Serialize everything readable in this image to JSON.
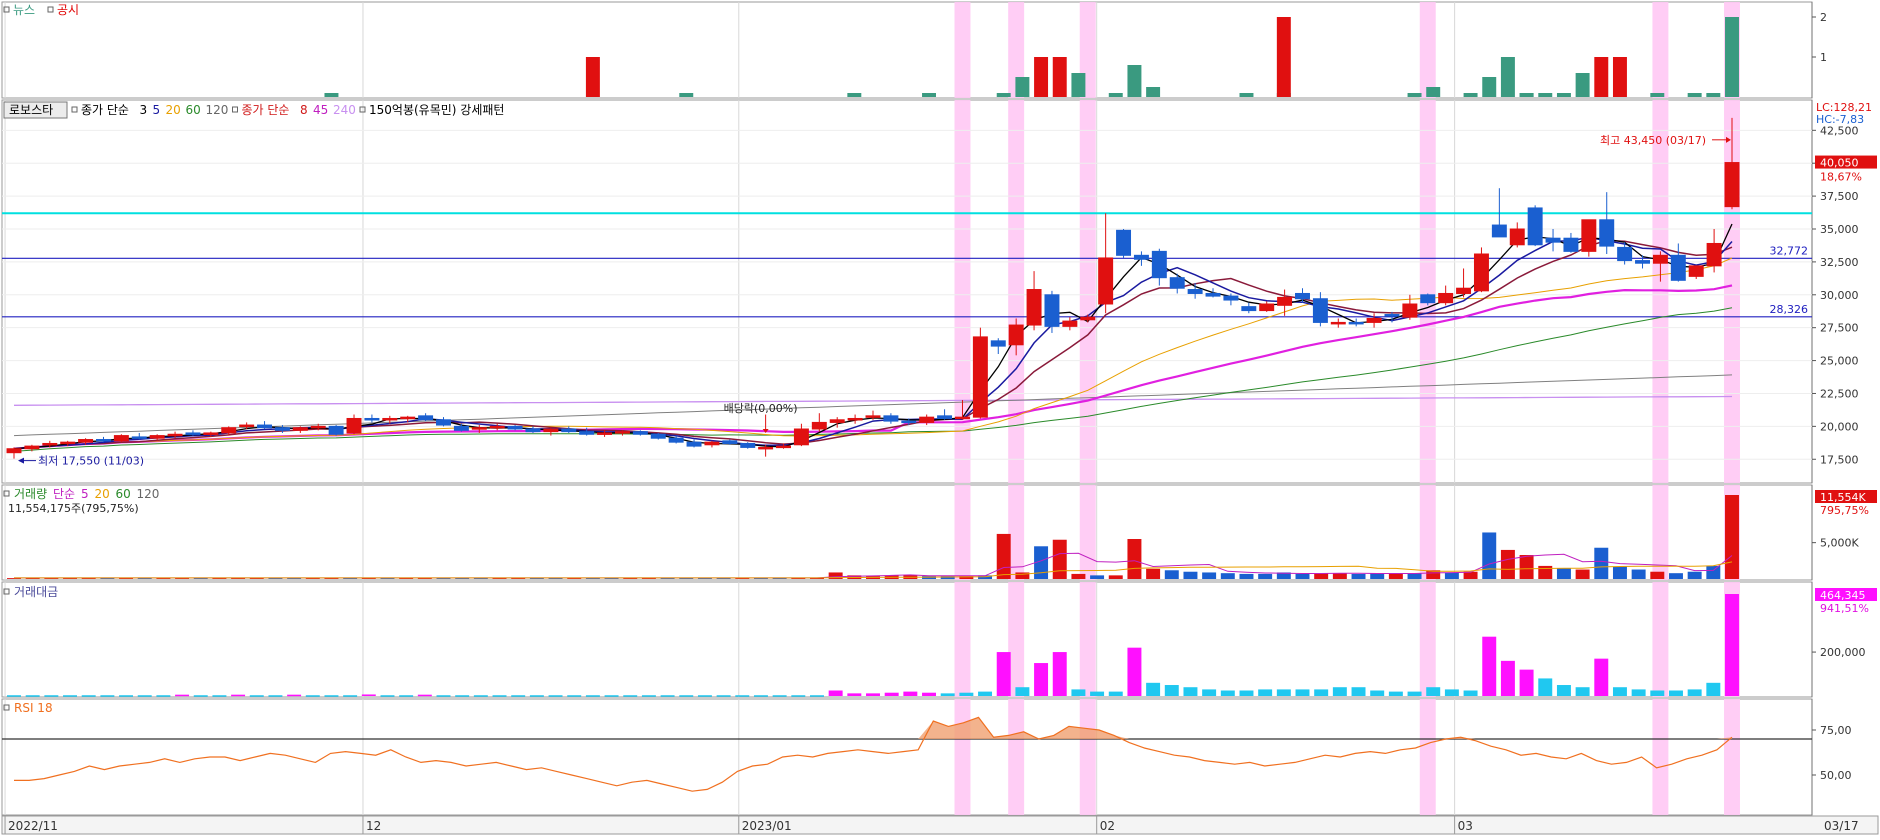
{
  "panels": {
    "news": {
      "legend": [
        "뉴스",
        "공시"
      ],
      "legend_colors": [
        "#3a9a80",
        "#e00000"
      ],
      "ticks": [
        "2",
        "1"
      ]
    },
    "price": {
      "legend_button": "로보스타",
      "legend_items": [
        {
          "text": "종가 단순",
          "color": "#000000"
        },
        {
          "text": "3",
          "color": "#000000"
        },
        {
          "text": "5",
          "color": "#1a1aa0"
        },
        {
          "text": "20",
          "color": "#e8a000"
        },
        {
          "text": "60",
          "color": "#2a8a2a"
        },
        {
          "text": "120",
          "color": "#666666"
        },
        {
          "text": "종가 단순",
          "color": "#d01a1a"
        },
        {
          "text": "8",
          "color": "#d01a1a"
        },
        {
          "text": "45",
          "color": "#c020c0"
        },
        {
          "text": "240",
          "color": "#c890f0"
        },
        {
          "text": "150억봉(유목민) 강세패턴",
          "color": "#000000"
        }
      ],
      "right_top_lc": "LC:128,21",
      "right_top_hc": "HC:-7,83",
      "current_price": "40,050",
      "current_change": "18,67%",
      "high_annotation": "최고 43,450 (03/17)",
      "low_annotation": "최저 17,550 (11/03)",
      "dividend_annotation": "배당락(0,00%)",
      "level_labels": [
        "32,772",
        "28,326"
      ],
      "ticks": [
        "42,500",
        "40,000",
        "37,500",
        "35,000",
        "32,500",
        "30,000",
        "27,500",
        "25,000",
        "22,500",
        "20,000",
        "17,500"
      ]
    },
    "volume": {
      "legend": [
        "거래량",
        "단순",
        "5",
        "20",
        "60",
        "120"
      ],
      "legend_colors": [
        "#2a8a2a",
        "#c020c0",
        "#c020c0",
        "#e8a000",
        "#2a8a2a",
        "#666666"
      ],
      "info": "11,554,175주(795,75%)",
      "current_value": "11,554K",
      "current_pct": "795,75%",
      "ticks": [
        "5,000K"
      ]
    },
    "amount": {
      "legend": "거래대금",
      "current_value": "464,345",
      "current_pct": "941,51%",
      "ticks": [
        "200,000"
      ]
    },
    "rsi": {
      "legend": "RSI 18",
      "ticks": [
        "75,00",
        "50,00"
      ]
    }
  },
  "x_axis": {
    "labels": [
      "2022/11",
      "12",
      "2023/01",
      "02",
      "03"
    ],
    "end_label": "03/17"
  },
  "chart_data": {
    "type": "candlestick",
    "symbol": "로보스타",
    "n_bars": 84,
    "ylim": [
      16000,
      44500
    ],
    "x_labels": [
      {
        "index": 0,
        "text": "2022/11"
      },
      {
        "index": 20,
        "text": "12"
      },
      {
        "index": 41,
        "text": "2023/01"
      },
      {
        "index": 61,
        "text": "02"
      },
      {
        "index": 81,
        "text": "03"
      }
    ],
    "highlight_bars": [
      53,
      56,
      60,
      79,
      92
    ],
    "horizontal_levels": [
      {
        "value": 36200,
        "color": "#00e0e0"
      },
      {
        "value": 32772,
        "color": "#2020c0"
      },
      {
        "value": 28326,
        "color": "#2020c0"
      }
    ],
    "ohlc": [
      [
        18000,
        18400,
        17550,
        18300
      ],
      [
        18300,
        18600,
        18100,
        18500
      ],
      [
        18600,
        18900,
        18400,
        18700
      ],
      [
        18700,
        18900,
        18500,
        18800
      ],
      [
        18800,
        19100,
        18600,
        19000
      ],
      [
        19000,
        19200,
        18800,
        18900
      ],
      [
        18900,
        19400,
        18800,
        19300
      ],
      [
        19200,
        19500,
        19000,
        19100
      ],
      [
        19100,
        19400,
        18900,
        19300
      ],
      [
        19300,
        19600,
        19100,
        19400
      ],
      [
        19500,
        19700,
        19300,
        19400
      ],
      [
        19400,
        19600,
        19200,
        19500
      ],
      [
        19500,
        20000,
        19300,
        19900
      ],
      [
        20000,
        20300,
        19800,
        20100
      ],
      [
        20100,
        20400,
        19800,
        19900
      ],
      [
        19900,
        20100,
        19500,
        19700
      ],
      [
        19700,
        20000,
        19500,
        19900
      ],
      [
        19900,
        20200,
        19700,
        20000
      ],
      [
        20000,
        20100,
        19300,
        19400
      ],
      [
        19500,
        20900,
        19400,
        20600
      ],
      [
        20600,
        20900,
        20300,
        20500
      ],
      [
        20500,
        20800,
        20200,
        20600
      ],
      [
        20600,
        20800,
        20300,
        20700
      ],
      [
        20800,
        21000,
        20400,
        20500
      ],
      [
        20500,
        20700,
        20000,
        20100
      ],
      [
        20000,
        20200,
        19600,
        19700
      ],
      [
        19800,
        20100,
        19500,
        19900
      ],
      [
        19900,
        20200,
        19700,
        20000
      ],
      [
        20000,
        20100,
        19700,
        19800
      ],
      [
        19800,
        20000,
        19500,
        19600
      ],
      [
        19600,
        19900,
        19300,
        19800
      ],
      [
        19800,
        20000,
        19500,
        19600
      ],
      [
        19600,
        19900,
        19300,
        19400
      ],
      [
        19400,
        19700,
        19200,
        19500
      ],
      [
        19500,
        19700,
        19300,
        19600
      ],
      [
        19600,
        19700,
        19300,
        19400
      ],
      [
        19400,
        19500,
        19000,
        19100
      ],
      [
        19100,
        19300,
        18700,
        18800
      ],
      [
        18800,
        19000,
        18400,
        18500
      ],
      [
        18600,
        18900,
        18400,
        18800
      ],
      [
        18900,
        19000,
        18600,
        18700
      ],
      [
        18700,
        18800,
        18300,
        18400
      ],
      [
        18300,
        18600,
        17700,
        18400
      ],
      [
        18400,
        18700,
        18300,
        18500
      ],
      [
        18600,
        20200,
        18500,
        19800
      ],
      [
        19800,
        21000,
        19600,
        20300
      ],
      [
        20300,
        20700,
        19900,
        20500
      ],
      [
        20500,
        20900,
        20200,
        20600
      ],
      [
        20700,
        21200,
        20500,
        20800
      ],
      [
        20800,
        21000,
        20200,
        20400
      ],
      [
        20400,
        20600,
        20100,
        20300
      ],
      [
        20300,
        20900,
        20100,
        20700
      ],
      [
        20800,
        21300,
        20500,
        20600
      ],
      [
        20600,
        22000,
        20500,
        20700
      ],
      [
        20700,
        27500,
        20600,
        26800
      ],
      [
        26500,
        26700,
        25500,
        26100
      ],
      [
        26200,
        28200,
        25400,
        27700
      ],
      [
        27700,
        31800,
        27300,
        30400
      ],
      [
        30000,
        30300,
        27100,
        27600
      ],
      [
        27600,
        28300,
        27300,
        28000
      ],
      [
        28100,
        28500,
        27900,
        28300
      ],
      [
        29300,
        36200,
        28600,
        32800
      ],
      [
        34900,
        35000,
        32800,
        33000
      ],
      [
        33000,
        33300,
        32200,
        32700
      ],
      [
        33300,
        33500,
        30700,
        31300
      ],
      [
        31300,
        31600,
        30100,
        30500
      ],
      [
        30400,
        30900,
        29700,
        30100
      ],
      [
        30100,
        30500,
        29800,
        29900
      ],
      [
        29900,
        30100,
        29200,
        29600
      ],
      [
        29100,
        29400,
        28600,
        28800
      ],
      [
        28800,
        29500,
        28700,
        29300
      ],
      [
        29200,
        30400,
        28400,
        29800
      ],
      [
        30100,
        30500,
        29400,
        29700
      ],
      [
        29700,
        30200,
        27600,
        27900
      ],
      [
        27800,
        28200,
        27500,
        27900
      ],
      [
        27900,
        28200,
        27600,
        27800
      ],
      [
        27900,
        28600,
        27500,
        28200
      ],
      [
        28500,
        28700,
        27900,
        28400
      ],
      [
        28300,
        30000,
        28100,
        29300
      ],
      [
        30000,
        30100,
        29200,
        29400
      ],
      [
        29400,
        30700,
        29200,
        30100
      ],
      [
        30100,
        32000,
        29800,
        30500
      ],
      [
        30300,
        33600,
        30200,
        33100
      ],
      [
        35300,
        38100,
        34500,
        34400
      ],
      [
        33800,
        35500,
        33600,
        35000
      ],
      [
        36600,
        36800,
        33700,
        33800
      ],
      [
        34300,
        35000,
        33300,
        34000
      ],
      [
        34300,
        34700,
        33200,
        33300
      ],
      [
        33300,
        34500,
        32900,
        35700
      ],
      [
        35700,
        37800,
        33100,
        33700
      ],
      [
        33600,
        34000,
        32300,
        32600
      ],
      [
        32600,
        33000,
        32000,
        32400
      ],
      [
        32400,
        33300,
        31000,
        33000
      ],
      [
        33000,
        33900,
        31000,
        31100
      ],
      [
        31400,
        32000,
        31200,
        32200
      ],
      [
        32200,
        35000,
        31700,
        33900
      ],
      [
        36700,
        43450,
        36500,
        40050
      ]
    ],
    "news_counts": [],
    "filing_counts": [],
    "volume_k": [],
    "amount": [],
    "rsi": []
  }
}
